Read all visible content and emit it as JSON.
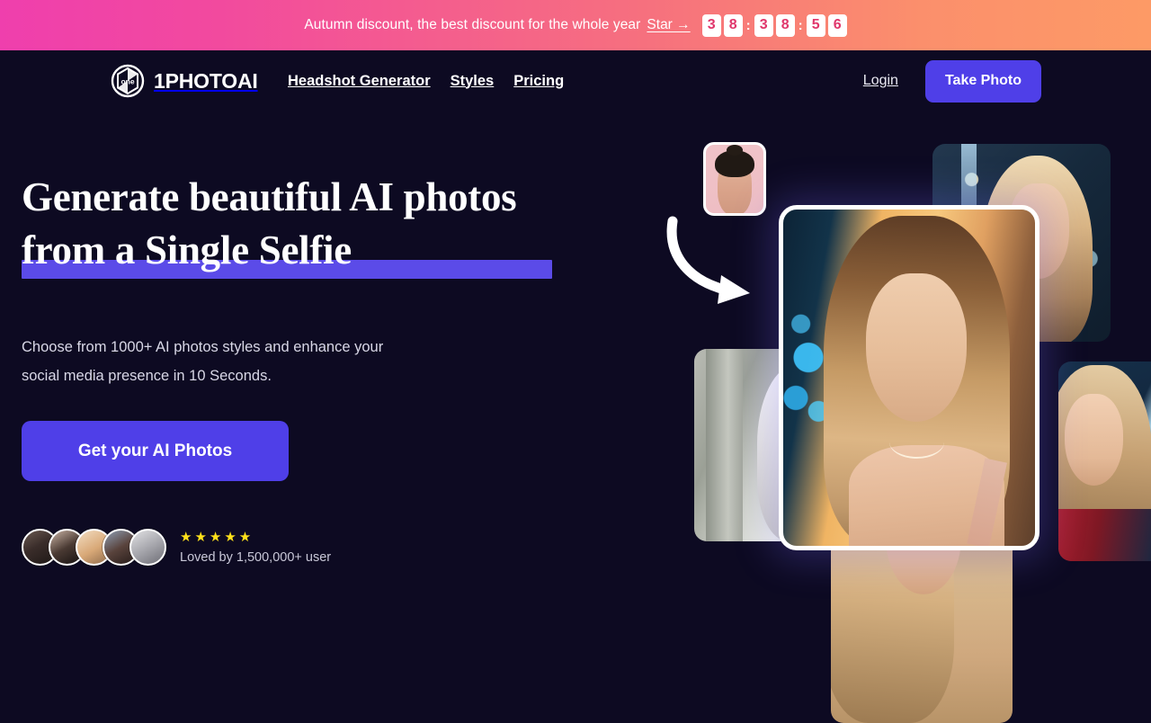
{
  "promo": {
    "text": "Autumn discount, the best discount for the whole year",
    "link_label": "Star →",
    "timer": {
      "hours": [
        "3",
        "8"
      ],
      "minutes": [
        "3",
        "8"
      ],
      "seconds": [
        "5",
        "6"
      ],
      "separator": ":"
    },
    "gradient_start": "#ef3fad",
    "gradient_end": "#fd9a66",
    "digit_color": "#e0366b"
  },
  "nav": {
    "brand_name": "1PHOTOAI",
    "brand_mark_label": "one",
    "links": [
      {
        "label": "Headshot Generator"
      },
      {
        "label": "Styles"
      },
      {
        "label": "Pricing"
      }
    ],
    "login_label": "Login",
    "cta_label": "Take Photo",
    "cta_color": "#4f3fe8"
  },
  "hero": {
    "headline_line1": "Generate beautiful AI photos",
    "headline_line2": "from a Single Selfie",
    "highlight_color": "#5b4be8",
    "subtitle_line1": "Choose from 1000+ AI photos styles and enhance your",
    "subtitle_line2": "social media presence in 10 Seconds.",
    "cta_label": "Get your AI Photos",
    "cta_color": "#4f3fe8"
  },
  "social_proof": {
    "avatar_count": 5,
    "stars": "★★★★★",
    "star_color": "#ffe11b",
    "loved_text": "Loved by 1,500,000+ user"
  },
  "collage": {
    "cards": [
      {
        "name": "input-selfie-thumbnail"
      },
      {
        "name": "generated-photo-top-right"
      },
      {
        "name": "generated-photo-left"
      },
      {
        "name": "generated-photo-right"
      },
      {
        "name": "generated-photo-bottom"
      },
      {
        "name": "generated-photo-main"
      }
    ]
  },
  "page": {
    "background": "#0d0a22"
  }
}
